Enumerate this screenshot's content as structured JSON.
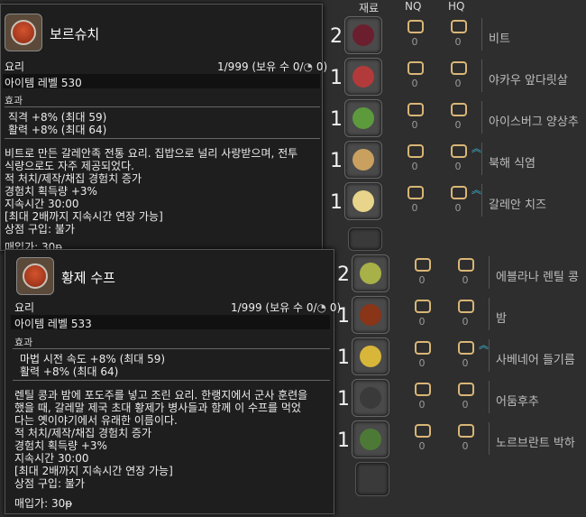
{
  "columns": {
    "material": "재료",
    "nq": "NQ",
    "hq": "HQ"
  },
  "recipe1": [
    {
      "qty": "2",
      "name": "비트",
      "nq": "0",
      "hq": "0",
      "hq_marker": false,
      "color": "#6b1f2e"
    },
    {
      "qty": "1",
      "name": "야카우 앞다릿살",
      "nq": "0",
      "hq": "0",
      "hq_marker": false,
      "color": "#b33a3a"
    },
    {
      "qty": "1",
      "name": "아이스버그 양상추",
      "nq": "0",
      "hq": "0",
      "hq_marker": false,
      "color": "#5c9a3c"
    },
    {
      "qty": "1",
      "name": "북해 식염",
      "nq": "0",
      "hq": "0",
      "hq_marker": true,
      "color": "#c9a060"
    },
    {
      "qty": "1",
      "name": "갈레안 치즈",
      "nq": "0",
      "hq": "0",
      "hq_marker": true,
      "color": "#e8d48a"
    }
  ],
  "recipe2": [
    {
      "qty": "2",
      "name": "에블라나 렌틸 콩",
      "nq": "0",
      "hq": "0",
      "hq_marker": false,
      "color": "#a8b048"
    },
    {
      "qty": "1",
      "name": "밤",
      "nq": "0",
      "hq": "0",
      "hq_marker": false,
      "color": "#8a3418"
    },
    {
      "qty": "1",
      "name": "사베네어 들기름",
      "nq": "0",
      "hq": "0",
      "hq_marker": true,
      "color": "#d8b63a"
    },
    {
      "qty": "1",
      "name": "어둠후추",
      "nq": "0",
      "hq": "0",
      "hq_marker": false,
      "color": "#3a3a3a"
    },
    {
      "qty": "1",
      "name": "노르브란트 박하",
      "nq": "0",
      "hq": "0",
      "hq_marker": false,
      "color": "#4c7a36"
    }
  ],
  "tooltip1": {
    "title": "보르슈치",
    "category": "요리",
    "stock": "1/999 (보유 수 0/",
    "stock_tail": " 0)",
    "item_level": "아이템 레벨 530",
    "effects_label": "효과",
    "effects": [
      "직격 +8% (최대 59)",
      "활력 +8% (최대 64)"
    ],
    "desc": [
      "비트로 만든 갈레안족 전통 요리. 집밥으로 널리 사랑받으며, 전투",
      "식량으로도 자주 제공되었다."
    ],
    "bonus": [
      "적 처치/제작/채집 경험치 증가",
      "경험치 획득량 +3%",
      "지속시간 30:00",
      "[최대 2배까지 지속시간 연장 가능]",
      "상점 구입: 불가",
      "매입가: 30ᵽ"
    ]
  },
  "tooltip2": {
    "title": "황제 수프",
    "category": "요리",
    "stock": "1/999 (보유 수 0/",
    "stock_tail": " 0)",
    "item_level": "아이템 레벨 533",
    "effects_label": "효과",
    "effects": [
      "마법 시전 속도 +8% (최대 59)",
      "활력 +8% (최대 64)"
    ],
    "desc": [
      "렌틸 콩과 밤에 포도주를 넣고 조린 요리. 한랭지에서 군사 훈련을",
      "했을 때, 갈레말 제국 초대 황제가 병사들과 함께 이 수프를 먹었",
      "다는 옛이야기에서 유래한 이름이다."
    ],
    "bonus": [
      "적 처치/제작/채집 경험치 증가",
      "경험치 획득량 +3%",
      "지속시간 30:00",
      "[최대 2배까지 지속시간 연장 가능]",
      "상점 구입: 불가",
      "매입가: 30ᵽ"
    ]
  }
}
